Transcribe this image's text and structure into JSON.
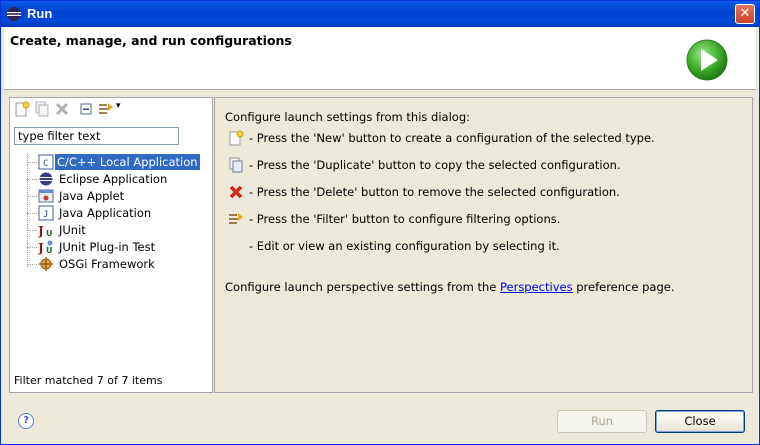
{
  "window": {
    "title": "Run",
    "close_glyph": "✕"
  },
  "header": {
    "title": "Create, manage, and run configurations"
  },
  "toolbar": {
    "new_icon": "new-config-icon",
    "duplicate_icon": "duplicate-icon",
    "delete_icon": "delete-icon",
    "collapse_icon": "collapse-all-icon",
    "filter_icon": "filter-icon",
    "dropdown_glyph": "▾"
  },
  "filter": {
    "placeholder": "type filter text",
    "value": "type filter text"
  },
  "tree": {
    "items": [
      {
        "label": "C/C++ Local Application",
        "icon": "c-app-icon",
        "selected": true
      },
      {
        "label": "Eclipse Application",
        "icon": "eclipse-icon"
      },
      {
        "label": "Java Applet",
        "icon": "java-applet-icon"
      },
      {
        "label": "Java Application",
        "icon": "java-app-icon"
      },
      {
        "label": "JUnit",
        "icon": "junit-icon"
      },
      {
        "label": "JUnit Plug-in Test",
        "icon": "junit-plugin-icon"
      },
      {
        "label": "OSGi Framework",
        "icon": "osgi-icon"
      }
    ]
  },
  "status": "Filter matched 7 of 7 items",
  "info": {
    "intro": "Configure launch settings from this dialog:",
    "new": "- Press the 'New' button to create a configuration of the selected type.",
    "duplicate": "- Press the 'Duplicate' button to copy the selected configuration.",
    "delete": "- Press the 'Delete' button to remove the selected configuration.",
    "filter": "- Press the 'Filter' button to configure filtering options.",
    "edit": "- Edit or view an existing configuration by selecting it.",
    "perspective_prefix": "Configure launch perspective settings from the ",
    "perspective_link": "Perspectives",
    "perspective_suffix": " preference page."
  },
  "buttons": {
    "run": "Run",
    "close": "Close",
    "help": "?"
  },
  "colors": {
    "selection": "#316ac5",
    "title_bar": "#0048d9",
    "dialog_bg": "#ece9d8"
  }
}
